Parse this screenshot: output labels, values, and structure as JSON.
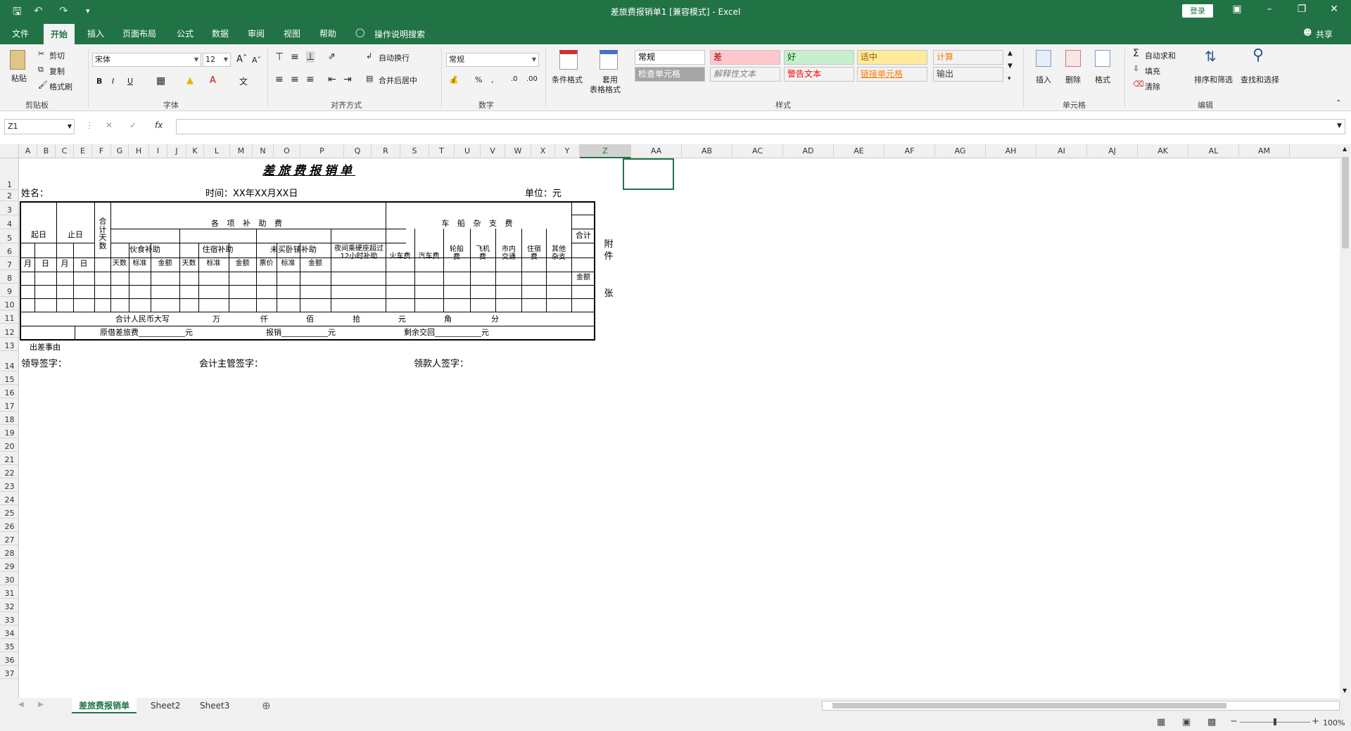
{
  "window": {
    "title": "差旅费报销单1  [兼容模式]  -  Excel",
    "login": "登录"
  },
  "tabs": [
    "文件",
    "开始",
    "插入",
    "页面布局",
    "公式",
    "数据",
    "审阅",
    "视图",
    "帮助"
  ],
  "tellme": "操作说明搜索",
  "share": "共享",
  "ribbon": {
    "clipboard": {
      "paste": "粘贴",
      "cut": "剪切",
      "copy": "复制",
      "painter": "格式刷",
      "label": "剪贴板"
    },
    "font": {
      "name": "宋体",
      "size": "12",
      "label": "字体"
    },
    "align": {
      "wrap": "自动换行",
      "merge": "合并后居中",
      "label": "对齐方式"
    },
    "number": {
      "format": "常规",
      "label": "数字"
    },
    "styles": {
      "cond": "条件格式",
      "table1": "套用",
      "table2": "表格格式",
      "cells": [
        {
          "text": "常规",
          "bg": "#ffffff",
          "fg": "#000000"
        },
        {
          "text": "差",
          "bg": "#ffc7ce",
          "fg": "#9c0006"
        },
        {
          "text": "好",
          "bg": "#c6efce",
          "fg": "#006100"
        },
        {
          "text": "适中",
          "bg": "#ffeb9c",
          "fg": "#9c5700"
        },
        {
          "text": "计算",
          "bg": "#f2f2f2",
          "fg": "#fa7d00"
        },
        {
          "text": "检查单元格",
          "bg": "#a5a5a5",
          "fg": "#ffffff"
        },
        {
          "text": "解释性文本",
          "bg": "#f3f3f3",
          "fg": "#7f7f7f"
        },
        {
          "text": "警告文本",
          "bg": "#f3f3f3",
          "fg": "#ff0000"
        },
        {
          "text": "链接单元格",
          "bg": "#f3f3f3",
          "fg": "#fa7d00"
        },
        {
          "text": "输出",
          "bg": "#f2f2f2",
          "fg": "#3f3f3f"
        }
      ],
      "label": "样式"
    },
    "cells": {
      "insert": "插入",
      "delete": "删除",
      "format": "格式",
      "label": "单元格"
    },
    "editing": {
      "autosum": "自动求和",
      "fill": "填充",
      "clear": "清除",
      "sort": "排序和筛选",
      "find": "查找和选择",
      "label": "编辑"
    }
  },
  "formula_bar": {
    "name_box": "Z1",
    "fx": "fx",
    "value": ""
  },
  "columns": [
    "A",
    "B",
    "C",
    "E",
    "F",
    "G",
    "H",
    "I",
    "J",
    "K",
    "L",
    "M",
    "N",
    "O",
    "P",
    "Q",
    "R",
    "S",
    "T",
    "U",
    "V",
    "W",
    "X",
    "Y",
    "Z",
    "AA",
    "AB",
    "AC",
    "AD",
    "AE",
    "AF",
    "AG",
    "AH",
    "AI",
    "AJ",
    "AK",
    "AL",
    "AM"
  ],
  "rows": [
    "1",
    "2",
    "3",
    "4",
    "5",
    "6",
    "7",
    "8",
    "9",
    "10",
    "11",
    "12",
    "13",
    "14",
    "15",
    "16",
    "17",
    "18",
    "19",
    "20",
    "21",
    "22",
    "23",
    "24",
    "25",
    "26",
    "27",
    "28",
    "29",
    "30",
    "31",
    "32",
    "33",
    "34",
    "35",
    "36",
    "37"
  ],
  "form": {
    "title": "差旅费报销单",
    "name_label": "姓名：",
    "time_label": "时间：XX年XX月XX日",
    "unit_label": "单位：元",
    "start": "起日",
    "end": "止日",
    "total_days": "合计天数",
    "subsidy": "各 项 补 助 费",
    "transport": "车 船 杂 支 费",
    "total": "合计",
    "meal": "伙食补助",
    "lodging": "住宿补助",
    "sleeper": "未买卧铺补助",
    "night": "夜间乘硬座超过12小时补助",
    "train": "火车费",
    "car": "汽车费",
    "ship": "轮船费",
    "plane": "飞机费",
    "city": "市内交通",
    "hotel": "住宿费",
    "misc": "其他杂支",
    "month": "月",
    "day": "日",
    "days": "天数",
    "standard": "标准",
    "amount": "金额",
    "ticket": "票价",
    "attach": "附件",
    "sheets": "张",
    "rmb_total": "合计人民币大写",
    "units": [
      "万",
      "仟",
      "佰",
      "拾",
      "元",
      "角",
      "分"
    ],
    "borrowed": "原借差旅费____________元",
    "reimbursed": "报销____________元",
    "returned": "剩余交回____________元",
    "reason": "出差事由",
    "leader_sign": "领导签字：",
    "acct_sign": "会计主管签字：",
    "payee_sign": "领款人签字："
  },
  "sheet_tabs": [
    "差旅费报销单",
    "Sheet2",
    "Sheet3"
  ],
  "zoom": "100%"
}
